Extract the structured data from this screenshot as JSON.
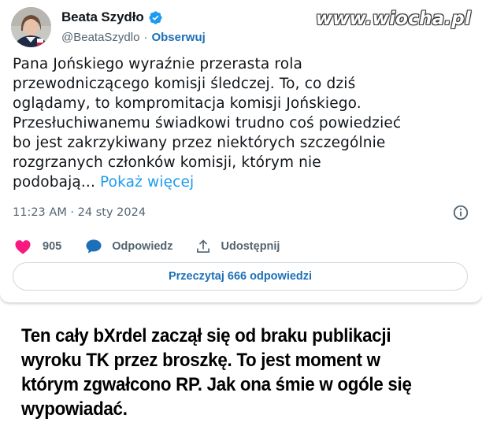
{
  "colors": {
    "accent": "#1d9bf0",
    "link_dark": "#1d6fb8",
    "like_heart": "#f91880",
    "muted": "#536471",
    "text": "#0f1419",
    "verified_badge": "#1d9bf0"
  },
  "watermark": {
    "text": "www.wiocha.pl"
  },
  "tweet": {
    "author": {
      "name": "Beata Szydło",
      "handle": "@BeataSzydlo",
      "separator": "·",
      "follow_label": "Obserwuj",
      "verified_icon": "verified-badge-icon",
      "avatar": "avatar-photo"
    },
    "body_lines": [
      "Pana Jońskiego wyraźnie przerasta rola",
      "przewodniczącego komisji śledczej. To, co dziś",
      "oglądamy, to kompromitacja komisji Jońskiego.",
      "Przesłuchiwanemu świadkowi trudno coś powiedzieć",
      "bo jest zakrzykiwany przez niektórych szczególnie",
      "rozgrzanych członków komisji, którym nie"
    ],
    "body_last_line": "podobają...",
    "show_more_label": "Pokaż więcej",
    "timestamp": "11:23 AM · 24 sty 2024",
    "info_icon": "info-icon",
    "actions": {
      "like_count": "905",
      "reply_label": "Odpowiedz",
      "share_label": "Udostępnij"
    },
    "read_replies_label": "Przeczytaj 666 odpowiedzi"
  },
  "comment": {
    "lines": [
      "Ten cały bXrdel zaczął się od braku publikacji",
      "wyroku TK przez broszkę. To jest moment w",
      "którym zgwałcono RP. Jak ona śmie w ogóle się",
      "wypowiadać."
    ]
  }
}
